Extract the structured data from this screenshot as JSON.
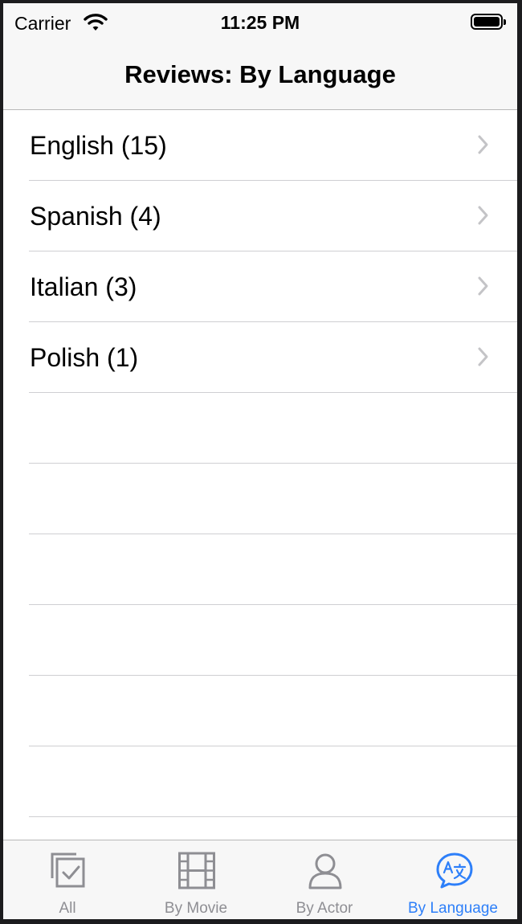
{
  "status_bar": {
    "carrier": "Carrier",
    "time": "11:25 PM"
  },
  "nav": {
    "title": "Reviews: By Language"
  },
  "rows": [
    {
      "label": "English (15)"
    },
    {
      "label": "Spanish (4)"
    },
    {
      "label": "Italian (3)"
    },
    {
      "label": "Polish (1)"
    }
  ],
  "tabs": [
    {
      "label": "All",
      "icon": "checked-documents-icon"
    },
    {
      "label": "By Movie",
      "icon": "film-icon"
    },
    {
      "label": "By Actor",
      "icon": "person-icon"
    },
    {
      "label": "By Language",
      "icon": "translate-bubble-icon",
      "selected": true
    }
  ],
  "colors": {
    "accent": "#2d7ff9",
    "tab_inactive": "#8e8e93",
    "bar_background": "#f7f7f7"
  }
}
